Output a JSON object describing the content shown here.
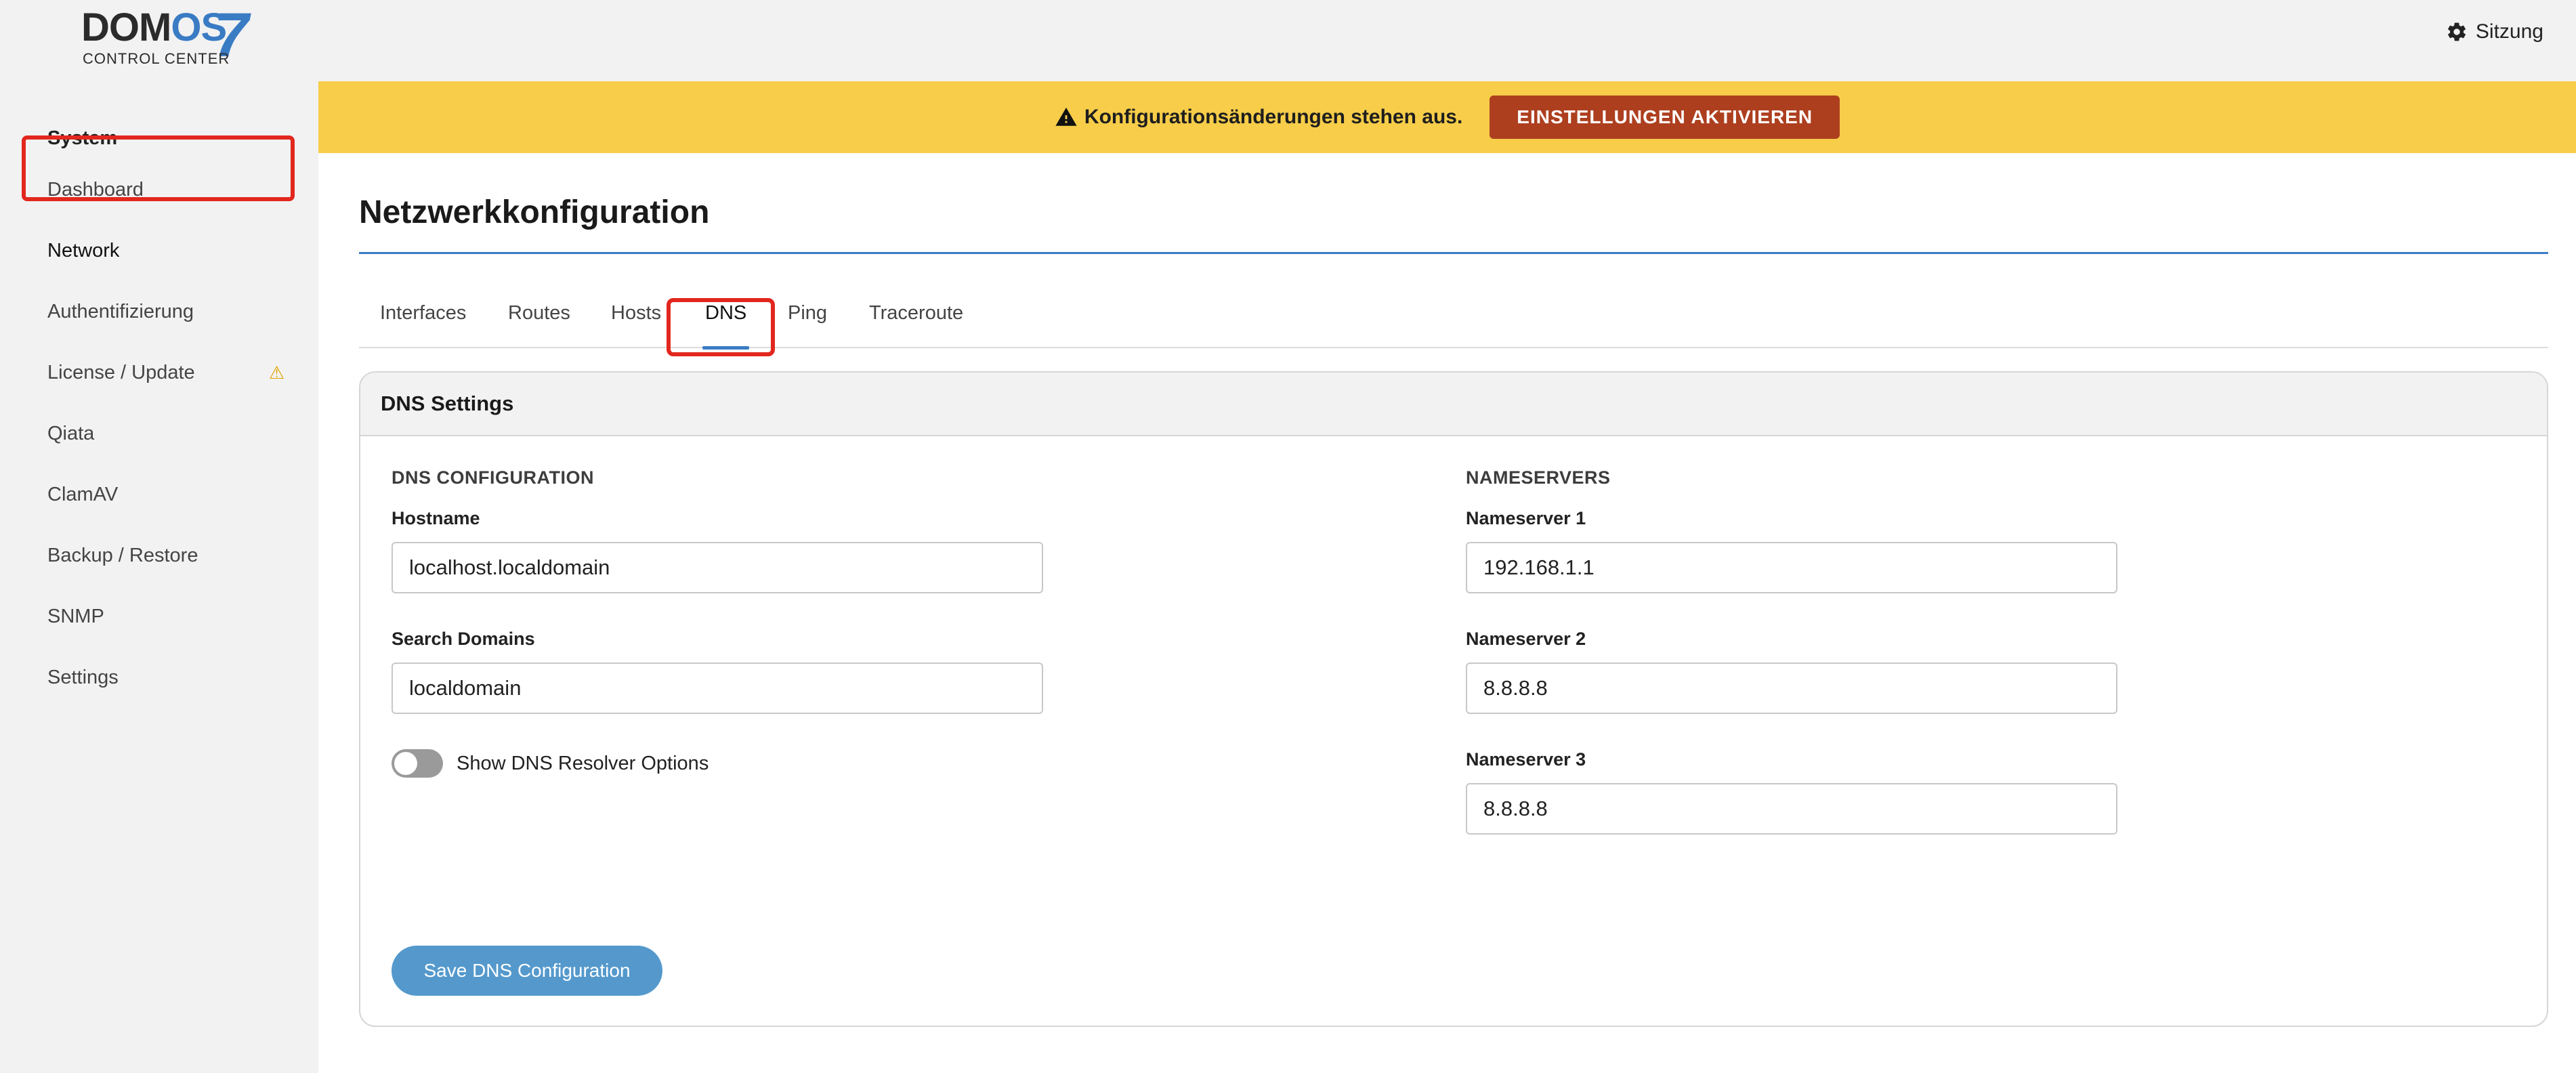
{
  "logo": {
    "main_prefix": "DOM",
    "main_os": "OS",
    "version": "7",
    "sub": "CONTROL CENTER"
  },
  "header": {
    "session_label": "Sitzung",
    "session_icon": "gear-icon"
  },
  "sidebar": {
    "heading": "System",
    "items": [
      {
        "label": "Dashboard"
      },
      {
        "label": "Network",
        "active": true
      },
      {
        "label": "Authentifizierung"
      },
      {
        "label": "License / Update",
        "warning_icon": "warning-icon"
      },
      {
        "label": "Qiata"
      },
      {
        "label": "ClamAV"
      },
      {
        "label": "Backup / Restore"
      },
      {
        "label": "SNMP"
      },
      {
        "label": "Settings"
      }
    ]
  },
  "banner": {
    "message": "Konfigurationsänderungen stehen aus.",
    "button_label": "EINSTELLUNGEN AKTIVIEREN",
    "bg_color": "#f7cd49",
    "button_color": "#ad3f1f"
  },
  "main": {
    "title": "Netzwerkkonfiguration",
    "tabs": [
      {
        "label": "Interfaces"
      },
      {
        "label": "Routes"
      },
      {
        "label": "Hosts"
      },
      {
        "label": "DNS",
        "active": true
      },
      {
        "label": "Ping"
      },
      {
        "label": "Traceroute"
      }
    ]
  },
  "dns": {
    "card_title": "DNS Settings",
    "config_section": "DNS CONFIGURATION",
    "hostname_label": "Hostname",
    "hostname_value": "localhost.localdomain",
    "search_domains_label": "Search Domains",
    "search_domains_value": "localdomain",
    "resolver_toggle_label": "Show DNS Resolver Options",
    "resolver_toggle_on": false,
    "nameservers_section": "NAMESERVERS",
    "nameservers": [
      {
        "label": "Nameserver 1",
        "value": "192.168.1.1"
      },
      {
        "label": "Nameserver 2",
        "value": "8.8.8.8"
      },
      {
        "label": "Nameserver 3",
        "value": "8.8.8.8"
      }
    ],
    "save_label": "Save DNS Configuration"
  },
  "colors": {
    "accent": "#3a7cc4",
    "highlight": "#e2271e",
    "save_button": "#5599cc"
  }
}
